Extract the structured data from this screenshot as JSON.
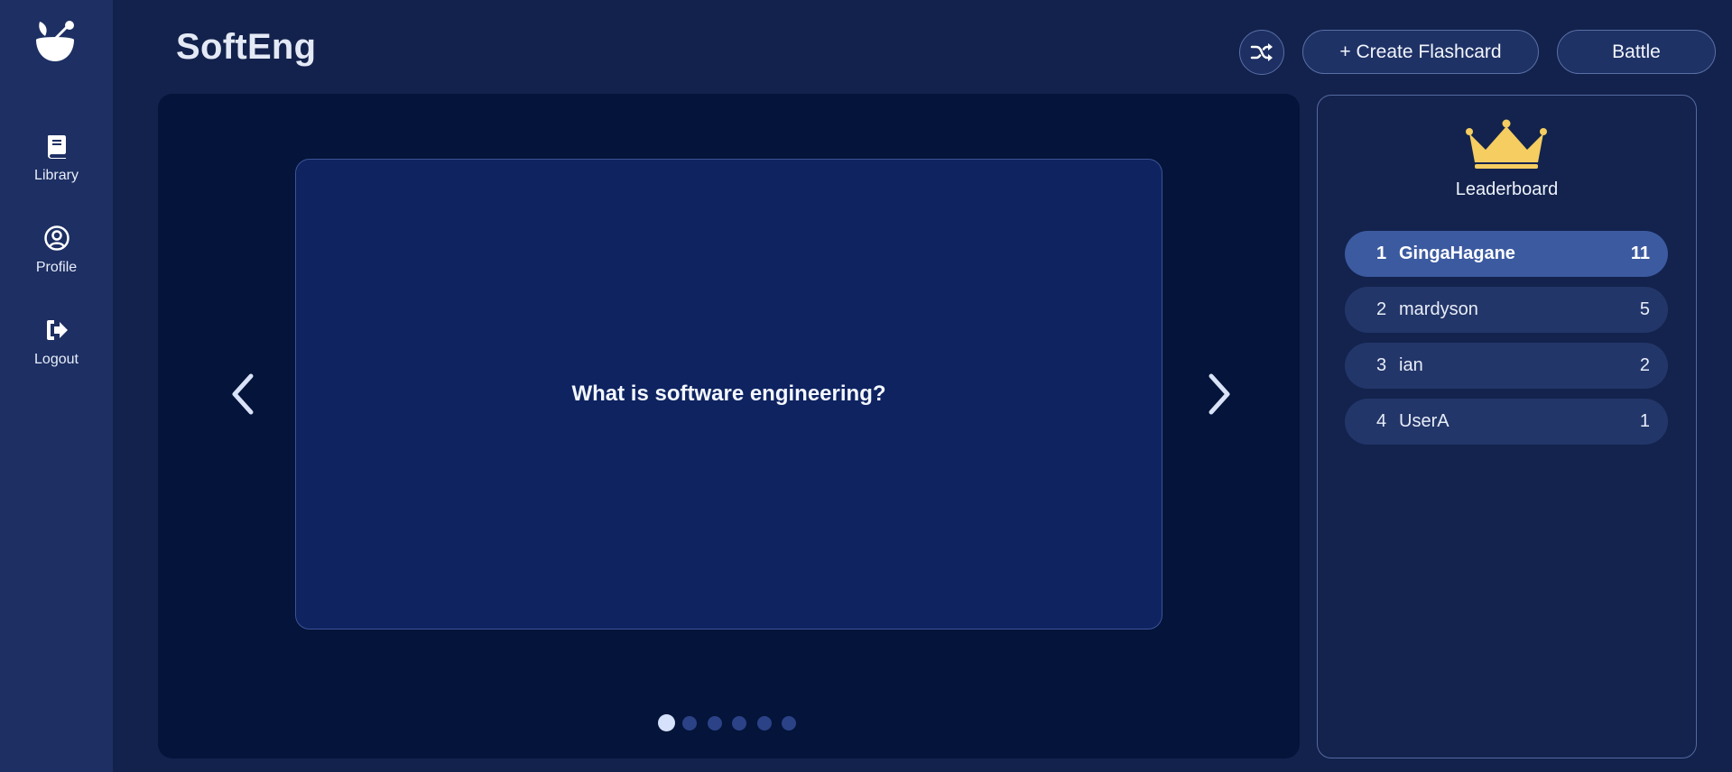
{
  "app": {
    "logo_icon": "bowl-with-leaf-icon"
  },
  "sidebar": {
    "items": [
      {
        "label": "Library",
        "icon": "book-icon"
      },
      {
        "label": "Profile",
        "icon": "user-circle-icon"
      },
      {
        "label": "Logout",
        "icon": "logout-icon"
      }
    ]
  },
  "header": {
    "title": "SoftEng",
    "shuffle_icon": "shuffle-icon",
    "create_label": "+ Create Flashcard",
    "battle_label": "Battle"
  },
  "flashcard": {
    "question": "What is software engineering?",
    "prev_icon": "chevron-left-icon",
    "next_icon": "chevron-right-icon",
    "total_cards": 6,
    "current_index": 1
  },
  "leaderboard": {
    "title": "Leaderboard",
    "icon": "crown-icon",
    "entries": [
      {
        "rank": "1",
        "name": "GingaHagane",
        "score": "11"
      },
      {
        "rank": "2",
        "name": "mardyson",
        "score": "5"
      },
      {
        "rank": "3",
        "name": "ian",
        "score": "2"
      },
      {
        "rank": "4",
        "name": "UserA",
        "score": "1"
      }
    ]
  },
  "colors": {
    "background": "#13224c",
    "sidebar": "#1d2f63",
    "viewer": "#04143a",
    "card": "#0e2360",
    "leaderboard_highlight": "#3c5aa0",
    "crown": "#f5cd60"
  }
}
